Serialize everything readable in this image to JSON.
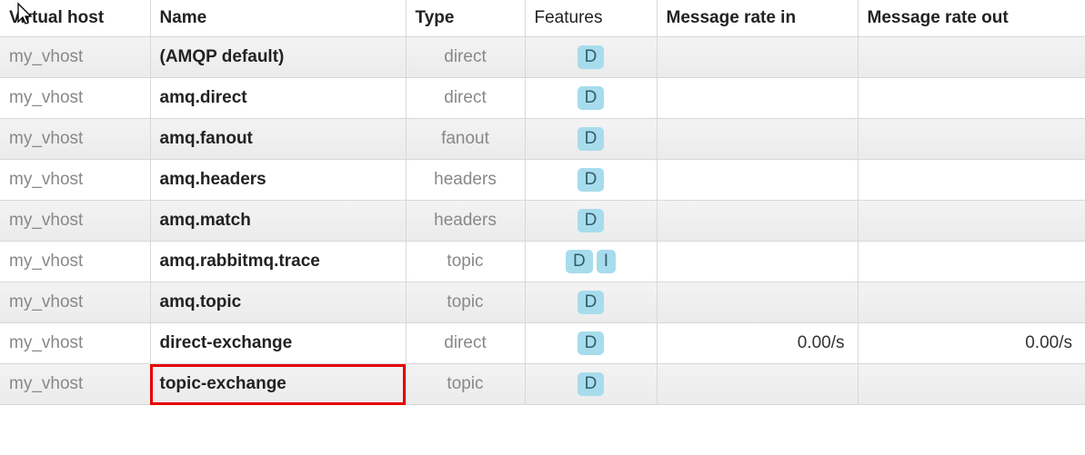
{
  "headers": {
    "vhost": "Virtual host",
    "name": "Name",
    "type": "Type",
    "features": "Features",
    "rate_in": "Message rate in",
    "rate_out": "Message rate out"
  },
  "badges": {
    "D": "D",
    "I": "I"
  },
  "rows": [
    {
      "vhost": "my_vhost",
      "name": "(AMQP default)",
      "type": "direct",
      "features": [
        "D"
      ],
      "rate_in": "",
      "rate_out": "",
      "highlighted": false
    },
    {
      "vhost": "my_vhost",
      "name": "amq.direct",
      "type": "direct",
      "features": [
        "D"
      ],
      "rate_in": "",
      "rate_out": "",
      "highlighted": false
    },
    {
      "vhost": "my_vhost",
      "name": "amq.fanout",
      "type": "fanout",
      "features": [
        "D"
      ],
      "rate_in": "",
      "rate_out": "",
      "highlighted": false
    },
    {
      "vhost": "my_vhost",
      "name": "amq.headers",
      "type": "headers",
      "features": [
        "D"
      ],
      "rate_in": "",
      "rate_out": "",
      "highlighted": false
    },
    {
      "vhost": "my_vhost",
      "name": "amq.match",
      "type": "headers",
      "features": [
        "D"
      ],
      "rate_in": "",
      "rate_out": "",
      "highlighted": false
    },
    {
      "vhost": "my_vhost",
      "name": "amq.rabbitmq.trace",
      "type": "topic",
      "features": [
        "D",
        "I"
      ],
      "rate_in": "",
      "rate_out": "",
      "highlighted": false
    },
    {
      "vhost": "my_vhost",
      "name": "amq.topic",
      "type": "topic",
      "features": [
        "D"
      ],
      "rate_in": "",
      "rate_out": "",
      "highlighted": false
    },
    {
      "vhost": "my_vhost",
      "name": "direct-exchange",
      "type": "direct",
      "features": [
        "D"
      ],
      "rate_in": "0.00/s",
      "rate_out": "0.00/s",
      "highlighted": false
    },
    {
      "vhost": "my_vhost",
      "name": "topic-exchange",
      "type": "topic",
      "features": [
        "D"
      ],
      "rate_in": "",
      "rate_out": "",
      "highlighted": true
    }
  ]
}
